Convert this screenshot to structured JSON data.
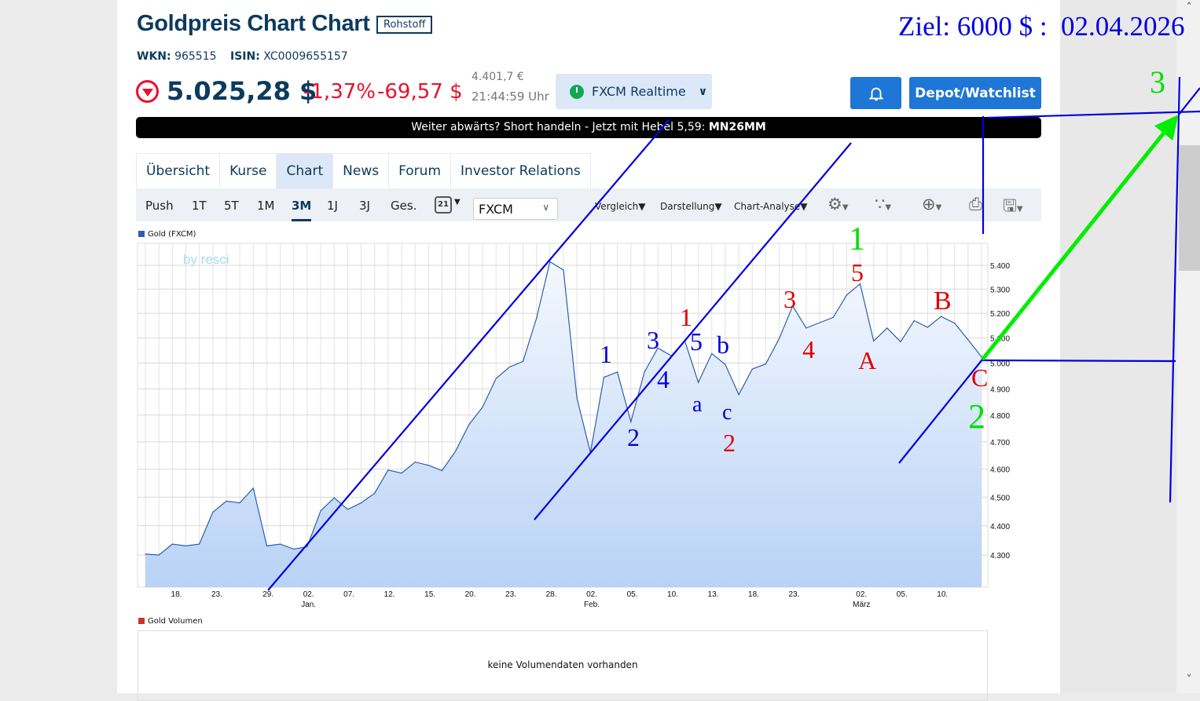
{
  "header": {
    "title": "Goldpreis Chart Chart",
    "badge": "Rohstoff",
    "wkn_label": "WKN:",
    "wkn": "965515",
    "isin_label": "ISIN:",
    "isin": "XC0009655157"
  },
  "quote": {
    "price": "5.025,28 $",
    "change_pct": "-1,37%",
    "change_abs": "-69,57 $",
    "price_eur": "4.401,7 €",
    "time": "21:44:59 Uhr",
    "source": "FXCM Realtime"
  },
  "buttons": {
    "depot": "Depot/Watchlist"
  },
  "banner": {
    "text": "Weiter abwärts? Short handeln - Jetzt mit Hebel 5,59: ",
    "code": "MN26MM"
  },
  "tabs": [
    {
      "label": "Übersicht"
    },
    {
      "label": "Kurse"
    },
    {
      "label": "Chart",
      "active": true
    },
    {
      "label": "News"
    },
    {
      "label": "Forum"
    },
    {
      "label": "Investor Relations"
    }
  ],
  "toolbar": {
    "ranges": [
      "Push",
      "1T",
      "5T",
      "1M",
      "3M",
      "1J",
      "3J",
      "Ges."
    ],
    "active_range": "3M",
    "calendar_day": "21",
    "exchange": "FXCM",
    "menus": [
      "Vergleich",
      "Darstellung",
      "Chart-Analyse"
    ]
  },
  "chart_data": {
    "type": "area",
    "title": "Gold (FXCM)",
    "watermark": "by resci",
    "series": [
      {
        "name": "Gold (FXCM)",
        "color": "#2a5fb0",
        "values": [
          4303,
          4300,
          4337,
          4331,
          4337,
          4447,
          4486,
          4480,
          4532,
          4331,
          4337,
          4320,
          4328,
          4452,
          4498,
          4457,
          4480,
          4514,
          4597,
          4586,
          4626,
          4614,
          4595,
          4666,
          4765,
          4830,
          4940,
          4985,
          5007,
          5180,
          5415,
          5380,
          4864,
          4661,
          4945,
          4965,
          4775,
          4965,
          5060,
          5029,
          5088,
          4925,
          5038,
          4995,
          4878,
          4977,
          4997,
          5098,
          5230,
          5140,
          5162,
          5183,
          5275,
          5322,
          5088,
          5140,
          5085,
          5170,
          5143,
          5187,
          5160,
          5093,
          5025
        ]
      }
    ],
    "y_ticks": [
      "5.400",
      "5.300",
      "5.200",
      "5.100",
      "5.000",
      "4.900",
      "4.800",
      "4.700",
      "4.600",
      "4.500",
      "4.400",
      "4.300"
    ],
    "y_tick_values": [
      5400,
      5300,
      5200,
      5100,
      5000,
      4900,
      4800,
      4700,
      4600,
      4500,
      4400,
      4300
    ],
    "ylim": [
      4210,
      5510
    ],
    "yscale": "log",
    "x_ticks": [
      {
        "label": "18.",
        "i": 2.3
      },
      {
        "label": "23.",
        "i": 5.3
      },
      {
        "label": "29.",
        "i": 9.1
      },
      {
        "label": "02.",
        "sub": "Jan.",
        "i": 12.1
      },
      {
        "label": "07.",
        "i": 15.1
      },
      {
        "label": "12.",
        "i": 18.1
      },
      {
        "label": "15.",
        "i": 21.1
      },
      {
        "label": "20.",
        "i": 24.1
      },
      {
        "label": "23.",
        "i": 27.1
      },
      {
        "label": "28.",
        "i": 30.1
      },
      {
        "label": "02.",
        "sub": "Feb.",
        "i": 33.1
      },
      {
        "label": "05.",
        "i": 36.1
      },
      {
        "label": "10.",
        "i": 39.1
      },
      {
        "label": "13.",
        "i": 42.1
      },
      {
        "label": "18.",
        "i": 45.1
      },
      {
        "label": "23.",
        "i": 48.1
      },
      {
        "label": "02.",
        "sub": "März",
        "i": 53.1
      },
      {
        "label": "05.",
        "i": 56.1
      },
      {
        "label": "10.",
        "i": 59.1
      }
    ],
    "grid": true
  },
  "volume": {
    "title": "Gold Volumen",
    "empty_text": "keine Volumendaten vorhanden"
  },
  "annotations": {
    "target": "Ziel: 6000 $ :  02.04.2026",
    "labels": [
      {
        "t": "3",
        "c": "#00e000"
      },
      {
        "t": "1",
        "c": "#00e000"
      },
      {
        "t": "2",
        "c": "#00e000"
      },
      {
        "t": "5",
        "c": "#e00000"
      },
      {
        "t": "3",
        "c": "#e00000"
      },
      {
        "t": "4",
        "c": "#e00000"
      },
      {
        "t": "1",
        "c": "#e00000"
      },
      {
        "t": "B",
        "c": "#e00000"
      },
      {
        "t": "A",
        "c": "#e00000"
      },
      {
        "t": "C",
        "c": "#e00000"
      },
      {
        "t": "2",
        "c": "#e00000"
      },
      {
        "t": "1",
        "c": "#0000e0"
      },
      {
        "t": "3",
        "c": "#0000e0"
      },
      {
        "t": "5",
        "c": "#0000e0"
      },
      {
        "t": "b",
        "c": "#0000e0"
      },
      {
        "t": "4",
        "c": "#0000e0"
      },
      {
        "t": "a",
        "c": "#0000e0"
      },
      {
        "t": "c",
        "c": "#0000e0"
      },
      {
        "t": "2",
        "c": "#0000e0"
      }
    ]
  }
}
